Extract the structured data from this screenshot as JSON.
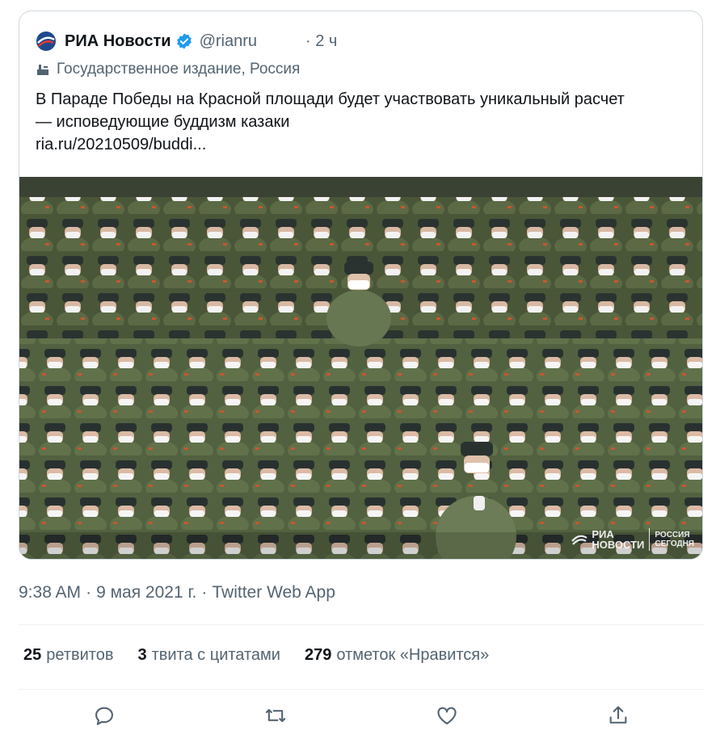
{
  "tweet": {
    "author_name": "РИА Новости",
    "handle": "@rianru",
    "time_ago": "· 2 ч",
    "label": "Государственное издание, Россия",
    "text_lines": [
      "В Параде Победы на Красной площади будет участвовать уникальный расчет",
      "— исповедующие буддизм казаки",
      "ria.ru/20210509/buddi..."
    ],
    "image_watermark": {
      "main": "РИА",
      "main2": "НОВОСТИ",
      "sub1": "РОССИЯ",
      "sub2": "СЕГОДНЯ"
    }
  },
  "meta": {
    "time": "9:38 AM",
    "date": "9 мая 2021 г.",
    "source": "Twitter Web App",
    "sep": "·"
  },
  "stats": {
    "retweets_count": "25",
    "retweets_label": "ретвитов",
    "quotes_count": "3",
    "quotes_label": "твита с цитатами",
    "likes_count": "279",
    "likes_label": "отметок «Нравится»"
  },
  "actions": [
    "reply-icon",
    "retweet-icon",
    "like-icon",
    "share-icon"
  ],
  "colors": {
    "text": "#0f1419",
    "secondary": "#536471",
    "verified": "#1d9bf0",
    "border": "#cfd9de"
  }
}
